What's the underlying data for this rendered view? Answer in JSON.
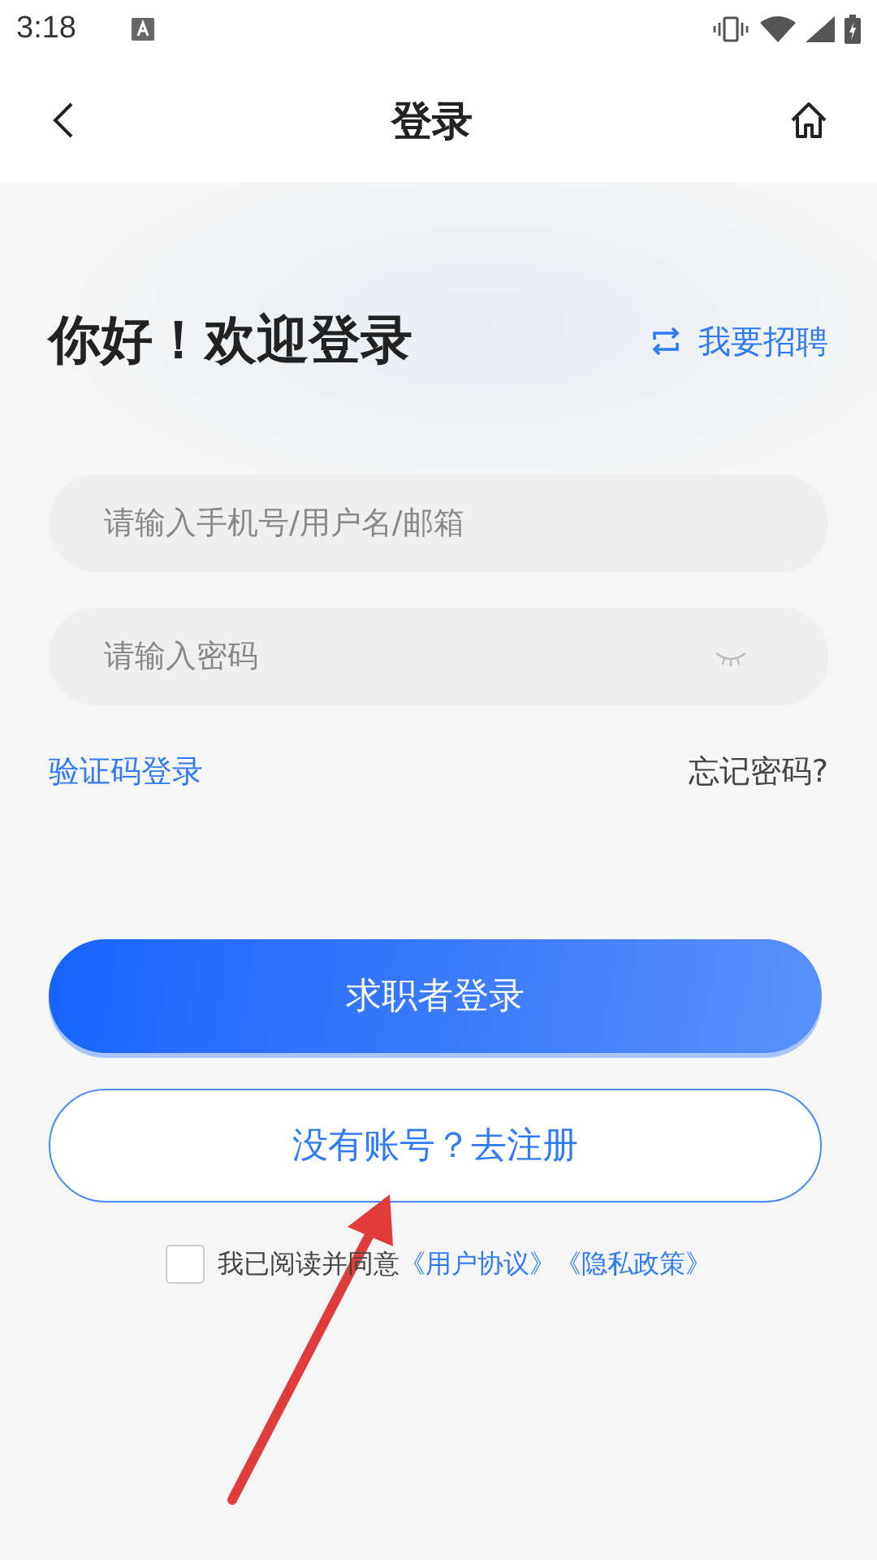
{
  "status_bar": {
    "time": "3:18"
  },
  "nav": {
    "title": "登录"
  },
  "heading": "你好！欢迎登录",
  "switch_link": "我要招聘",
  "fields": [
    {
      "kind": "text",
      "placeholder": "请输入手机号/用户名/邮箱"
    },
    {
      "kind": "password",
      "placeholder": "请输入密码"
    }
  ],
  "code_login_link": "验证码登录",
  "forgot_link": "忘记密码?",
  "login_button": "求职者登录",
  "register_button": "没有账号？去注册",
  "agreement": {
    "checked": false,
    "text": "我已阅读并同意",
    "links": [
      "《用户协议》",
      "《隐私政策》"
    ]
  },
  "annotation": {
    "kind": "arrow"
  }
}
